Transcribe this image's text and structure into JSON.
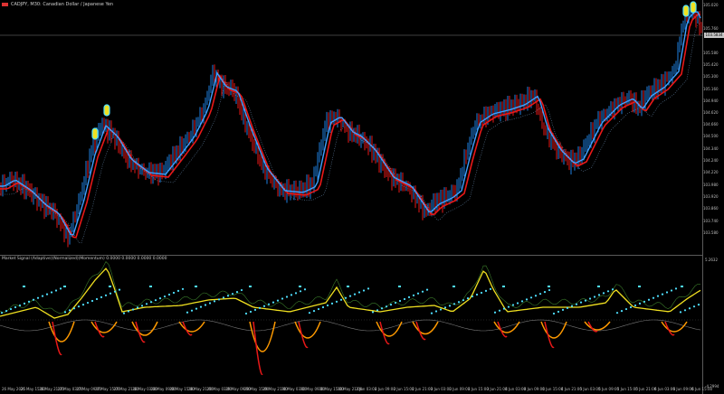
{
  "header": {
    "title": "CADJPY, M30: Canadian Dollar / Japanese Yen"
  },
  "indicator": {
    "title": "Market Signal (Adaptive)(Normalized)(Momentum) 0.0000 0.0000 0.0000 0.0000",
    "top_label": "5.2632",
    "bottom_label": "-4.2994"
  },
  "price_tag": "103.5834",
  "y_labels": [
    "105.020",
    "105.760",
    "105.580",
    "105.420",
    "105.300",
    "105.160",
    "104.940",
    "104.620",
    "104.660",
    "104.500",
    "104.340",
    "104.240",
    "104.220",
    "103.980",
    "103.920",
    "103.860",
    "103.740",
    "103.580"
  ],
  "x_labels": [
    "26 May 2025",
    "26 May 15:00",
    "26 May 21:00",
    "27 May 03:00",
    "27 May 09:00",
    "27 May 15:00",
    "27 May 21:00",
    "28 May 03:00",
    "28 May 09:00",
    "28 May 15:00",
    "28 May 21:00",
    "29 May 03:00",
    "29 May 09:00",
    "29 May 15:00",
    "29 May 21:00",
    "30 May 03:00",
    "30 May 09:00",
    "30 May 15:00",
    "30 May 21:00",
    "2 Jun 03:00",
    "2 Jun 09:00",
    "2 Jun 15:00",
    "2 Jun 21:00",
    "3 Jun 03:00",
    "3 Jun 09:00",
    "3 Jun 15:00",
    "3 Jun 21:00",
    "4 Jun 03:00",
    "4 Jun 09:00",
    "4 Jun 15:00",
    "4 Jun 21:00",
    "5 Jun 03:00",
    "5 Jun 09:00",
    "5 Jun 15:00",
    "5 Jun 21:00",
    "6 Jun 03:00",
    "6 Jun 09:00",
    "6 Jun 15:00"
  ],
  "colors": {
    "bull": "#1e7fe0",
    "bear": "#e81818",
    "ma_fast": "#3fa0ff",
    "ma_slow": "#e81818",
    "cyan": "#4fe0ff",
    "yellow": "#f0e020",
    "orange": "#ff9a00",
    "green": "#70e030",
    "grid": "#5a5a5a"
  }
}
